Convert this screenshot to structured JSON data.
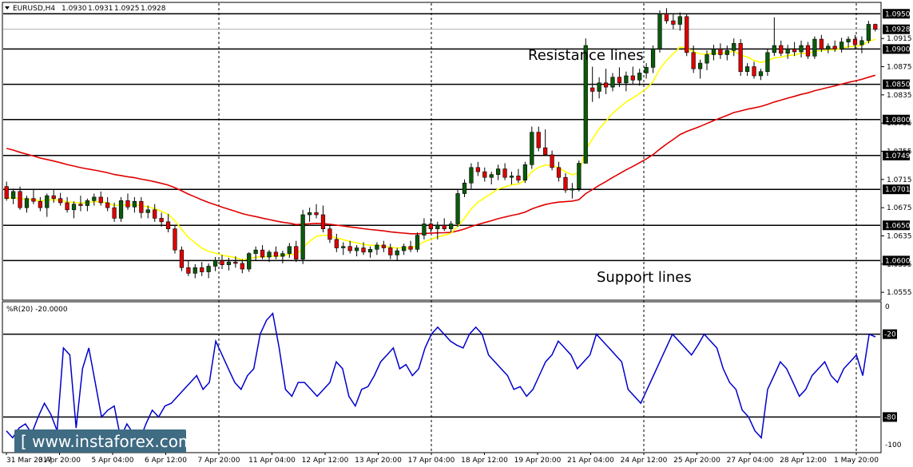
{
  "chart_data": {
    "type": "candlestick",
    "header": {
      "symbol_timeframe": "EURUSD,H4",
      "ohlc": [
        "1.0930",
        "1.0931",
        "1.0925",
        "1.0928"
      ]
    },
    "price_axis": {
      "range": [
        1.0545,
        1.0965
      ],
      "ticks": [
        "1.0915",
        "1.0875",
        "1.0835",
        "1.0795",
        "1.0755",
        "1.0715",
        "1.0675",
        "1.0635",
        "1.0595",
        "1.0555"
      ],
      "current_price": "1.0928"
    },
    "horizontal_levels": [
      {
        "value": 1.095,
        "label": "1.0950"
      },
      {
        "value": 1.09,
        "label": "1.0900"
      },
      {
        "value": 1.085,
        "label": "1.0850"
      },
      {
        "value": 1.08,
        "label": "1.0800"
      },
      {
        "value": 1.0749,
        "label": "1.0749"
      },
      {
        "value": 1.0701,
        "label": "1.0701"
      },
      {
        "value": 1.065,
        "label": "1.0650"
      },
      {
        "value": 1.06,
        "label": "1.0600"
      }
    ],
    "annotations": [
      "Resistance lines",
      "Support lines"
    ],
    "x_labels": [
      "31 Mar 2017",
      "3 Apr 20:00",
      "5 Apr 04:00",
      "6 Apr 12:00",
      "7 Apr 20:00",
      "11 Apr 04:00",
      "12 Apr 12:00",
      "13 Apr 20:00",
      "17 Apr 04:00",
      "18 Apr 12:00",
      "19 Apr 20:00",
      "21 Apr 04:00",
      "24 Apr 12:00",
      "25 Apr 20:00",
      "27 Apr 04:00",
      "28 Apr 12:00",
      "1 May 20:00"
    ],
    "candles": [
      [
        1.0705,
        1.0712,
        1.0685,
        1.0688
      ],
      [
        1.0688,
        1.0702,
        1.068,
        1.0698
      ],
      [
        1.0698,
        1.0705,
        1.0672,
        1.0675
      ],
      [
        1.0675,
        1.0692,
        1.0668,
        1.0688
      ],
      [
        1.0688,
        1.07,
        1.068,
        1.0684
      ],
      [
        1.0684,
        1.069,
        1.067,
        1.0675
      ],
      [
        1.0675,
        1.0695,
        1.0662,
        1.0692
      ],
      [
        1.0692,
        1.07,
        1.0682,
        1.0688
      ],
      [
        1.0688,
        1.0696,
        1.0678,
        1.0682
      ],
      [
        1.0682,
        1.069,
        1.0668,
        1.0672
      ],
      [
        1.0672,
        1.0684,
        1.066,
        1.068
      ],
      [
        1.068,
        1.0692,
        1.067,
        1.0678
      ],
      [
        1.0678,
        1.0688,
        1.067,
        1.0685
      ],
      [
        1.0685,
        1.0695,
        1.0678,
        1.069
      ],
      [
        1.069,
        1.0698,
        1.0678,
        1.0682
      ],
      [
        1.0682,
        1.069,
        1.067,
        1.0675
      ],
      [
        1.0675,
        1.0682,
        1.0655,
        1.066
      ],
      [
        1.066,
        1.069,
        1.0655,
        1.0685
      ],
      [
        1.0685,
        1.0695,
        1.0672,
        1.0676
      ],
      [
        1.0676,
        1.069,
        1.0668,
        1.0684
      ],
      [
        1.0684,
        1.069,
        1.066,
        1.0668
      ],
      [
        1.0668,
        1.0678,
        1.066,
        1.0672
      ],
      [
        1.0672,
        1.068,
        1.0655,
        1.066
      ],
      [
        1.066,
        1.0668,
        1.0648,
        1.0655
      ],
      [
        1.0655,
        1.0666,
        1.064,
        1.0645
      ],
      [
        1.0645,
        1.065,
        1.061,
        1.0615
      ],
      [
        1.0615,
        1.062,
        1.0585,
        1.059
      ],
      [
        1.059,
        1.06,
        1.0578,
        1.0582
      ],
      [
        1.0582,
        1.0595,
        1.0575,
        1.059
      ],
      [
        1.059,
        1.0598,
        1.0578,
        1.0584
      ],
      [
        1.0584,
        1.0596,
        1.0575,
        1.0592
      ],
      [
        1.0592,
        1.0605,
        1.0585,
        1.06
      ],
      [
        1.06,
        1.0608,
        1.0588,
        1.0594
      ],
      [
        1.0594,
        1.0604,
        1.0586,
        1.0598
      ],
      [
        1.0598,
        1.0606,
        1.059,
        1.0596
      ],
      [
        1.0596,
        1.0602,
        1.0582,
        1.0588
      ],
      [
        1.0588,
        1.0612,
        1.0584,
        1.061
      ],
      [
        1.061,
        1.062,
        1.06,
        1.0615
      ],
      [
        1.0615,
        1.0622,
        1.0602,
        1.0605
      ],
      [
        1.0605,
        1.0615,
        1.0598,
        1.0612
      ],
      [
        1.0612,
        1.062,
        1.0602,
        1.0606
      ],
      [
        1.0606,
        1.0614,
        1.0596,
        1.061
      ],
      [
        1.061,
        1.0625,
        1.0604,
        1.062
      ],
      [
        1.062,
        1.0628,
        1.0598,
        1.0602
      ],
      [
        1.0602,
        1.0672,
        1.0595,
        1.0665
      ],
      [
        1.0665,
        1.0675,
        1.0655,
        1.0668
      ],
      [
        1.0668,
        1.068,
        1.066,
        1.0665
      ],
      [
        1.0665,
        1.0678,
        1.064,
        1.0645
      ],
      [
        1.0645,
        1.065,
        1.0625,
        1.063
      ],
      [
        1.063,
        1.0638,
        1.0612,
        1.0618
      ],
      [
        1.0618,
        1.0626,
        1.0608,
        1.062
      ],
      [
        1.062,
        1.0628,
        1.061,
        1.0614
      ],
      [
        1.0614,
        1.0622,
        1.0606,
        1.0618
      ],
      [
        1.0618,
        1.0626,
        1.0608,
        1.0612
      ],
      [
        1.0612,
        1.062,
        1.0604,
        1.0616
      ],
      [
        1.0616,
        1.0626,
        1.0608,
        1.0622
      ],
      [
        1.0622,
        1.0628,
        1.0612,
        1.0618
      ],
      [
        1.0618,
        1.0624,
        1.0602,
        1.0608
      ],
      [
        1.0608,
        1.0618,
        1.06,
        1.0614
      ],
      [
        1.0614,
        1.0624,
        1.0608,
        1.062
      ],
      [
        1.062,
        1.0628,
        1.0612,
        1.0616
      ],
      [
        1.0616,
        1.064,
        1.0612,
        1.0636
      ],
      [
        1.0636,
        1.066,
        1.063,
        1.0652
      ],
      [
        1.0652,
        1.066,
        1.064,
        1.0645
      ],
      [
        1.0645,
        1.0655,
        1.063,
        1.065
      ],
      [
        1.065,
        1.066,
        1.0642,
        1.0645
      ],
      [
        1.0645,
        1.0656,
        1.064,
        1.0652
      ],
      [
        1.0652,
        1.07,
        1.0648,
        1.0695
      ],
      [
        1.0695,
        1.0715,
        1.069,
        1.071
      ],
      [
        1.071,
        1.0738,
        1.0702,
        1.0732
      ],
      [
        1.0732,
        1.074,
        1.072,
        1.0726
      ],
      [
        1.0726,
        1.0732,
        1.0712,
        1.0718
      ],
      [
        1.0718,
        1.0726,
        1.0708,
        1.0722
      ],
      [
        1.0722,
        1.0736,
        1.0714,
        1.073
      ],
      [
        1.073,
        1.0738,
        1.0714,
        1.0718
      ],
      [
        1.0718,
        1.0726,
        1.0708,
        1.072
      ],
      [
        1.072,
        1.073,
        1.071,
        1.0714
      ],
      [
        1.0714,
        1.074,
        1.071,
        1.0736
      ],
      [
        1.0736,
        1.079,
        1.073,
        1.0782
      ],
      [
        1.0782,
        1.079,
        1.0755,
        1.076
      ],
      [
        1.076,
        1.0786,
        1.0752,
        1.075
      ],
      [
        1.075,
        1.0756,
        1.0728,
        1.0732
      ],
      [
        1.0732,
        1.074,
        1.0712,
        1.0718
      ],
      [
        1.0718,
        1.0724,
        1.0696,
        1.07
      ],
      [
        1.07,
        1.071,
        1.0688,
        1.0702
      ],
      [
        1.0702,
        1.0742,
        1.0698,
        1.0738
      ],
      [
        1.0738,
        1.0915,
        1.082,
        1.0905
      ],
      [
        1.0845,
        1.0875,
        1.0825,
        1.084
      ],
      [
        1.084,
        1.086,
        1.083,
        1.0852
      ],
      [
        1.0852,
        1.0872,
        1.0836,
        1.0846
      ],
      [
        1.0846,
        1.0866,
        1.084,
        1.086
      ],
      [
        1.086,
        1.0874,
        1.0846,
        1.0852
      ],
      [
        1.0852,
        1.0868,
        1.084,
        1.0862
      ],
      [
        1.0862,
        1.0875,
        1.085,
        1.0856
      ],
      [
        1.0856,
        1.0872,
        1.0848,
        1.0866
      ],
      [
        1.0866,
        1.088,
        1.0858,
        1.0874
      ],
      [
        1.0874,
        1.0905,
        1.0866,
        1.09
      ],
      [
        1.09,
        1.0955,
        1.0895,
        1.095
      ],
      [
        1.095,
        1.0958,
        1.0936,
        1.094
      ],
      [
        1.094,
        1.095,
        1.0928,
        1.0935
      ],
      [
        1.0935,
        1.0952,
        1.0926,
        1.0946
      ],
      [
        1.0946,
        1.095,
        1.089,
        1.0895
      ],
      [
        1.0895,
        1.0905,
        1.0866,
        1.0872
      ],
      [
        1.0872,
        1.0885,
        1.0858,
        1.088
      ],
      [
        1.088,
        1.0898,
        1.087,
        1.0892
      ],
      [
        1.0892,
        1.0906,
        1.0884,
        1.09
      ],
      [
        1.09,
        1.0908,
        1.0886,
        1.0892
      ],
      [
        1.0892,
        1.0905,
        1.0884,
        1.0898
      ],
      [
        1.0898,
        1.0915,
        1.089,
        1.0908
      ],
      [
        1.0908,
        1.0914,
        1.0862,
        1.0868
      ],
      [
        1.0868,
        1.088,
        1.0862,
        1.0875
      ],
      [
        1.0875,
        1.0882,
        1.0858,
        1.0862
      ],
      [
        1.0862,
        1.0872,
        1.0856,
        1.0868
      ],
      [
        1.0868,
        1.09,
        1.0862,
        1.0895
      ],
      [
        1.0895,
        1.0945,
        1.089,
        1.0905
      ],
      [
        1.0905,
        1.0912,
        1.089,
        1.0894
      ],
      [
        1.0894,
        1.0906,
        1.0886,
        1.09
      ],
      [
        1.09,
        1.091,
        1.089,
        1.0896
      ],
      [
        1.0896,
        1.0912,
        1.0888,
        1.0905
      ],
      [
        1.0905,
        1.091,
        1.0886,
        1.089
      ],
      [
        1.089,
        1.0918,
        1.0886,
        1.0914
      ],
      [
        1.0914,
        1.092,
        1.0896,
        1.09
      ],
      [
        1.09,
        1.0908,
        1.0894,
        1.0904
      ],
      [
        1.0904,
        1.0912,
        1.0896,
        1.09
      ],
      [
        1.09,
        1.0916,
        1.0895,
        1.091
      ],
      [
        1.091,
        1.0918,
        1.0902,
        1.0914
      ],
      [
        1.0914,
        1.092,
        1.09,
        1.0906
      ],
      [
        1.0906,
        1.0918,
        1.0894,
        1.0912
      ],
      [
        1.0912,
        1.094,
        1.0908,
        1.0935
      ],
      [
        1.0935,
        1.0936,
        1.0925,
        1.0928
      ]
    ],
    "ema_fast_color": "#ffff00",
    "ema_slow_color": "#e00000",
    "williams_r": {
      "label": "%R(20) -20.0000",
      "range": [
        -100,
        0
      ],
      "levels": [
        {
          "value": -20,
          "label": "-20"
        },
        {
          "value": -80,
          "label": "-80"
        }
      ],
      "ticks": [
        "0",
        "-100"
      ],
      "line_color": "#0000cc",
      "values": [
        -90,
        -95,
        -88,
        -85,
        -92,
        -80,
        -70,
        -78,
        -90,
        -30,
        -35,
        -88,
        -45,
        -30,
        -55,
        -80,
        -75,
        -72,
        -95,
        -85,
        -92,
        -97,
        -85,
        -75,
        -80,
        -72,
        -70,
        -65,
        -60,
        -55,
        -50,
        -60,
        -55,
        -25,
        -35,
        -45,
        -55,
        -60,
        -50,
        -45,
        -20,
        -10,
        -5,
        -30,
        -60,
        -65,
        -55,
        -55,
        -60,
        -65,
        -60,
        -55,
        -40,
        -45,
        -65,
        -72,
        -60,
        -58,
        -50,
        -40,
        -35,
        -30,
        -45,
        -42,
        -50,
        -45,
        -30,
        -20,
        -15,
        -20,
        -25,
        -28,
        -30,
        -20,
        -15,
        -20,
        -35,
        -40,
        -45,
        -50,
        -60,
        -58,
        -65,
        -60,
        -50,
        -40,
        -35,
        -25,
        -30,
        -35,
        -45,
        -40,
        -35,
        -20,
        -25,
        -30,
        -35,
        -40,
        -60,
        -65,
        -70,
        -60,
        -50,
        -40,
        -30,
        -20,
        -25,
        -30,
        -35,
        -28,
        -20,
        -25,
        -30,
        -45,
        -55,
        -60,
        -75,
        -80,
        -90,
        -95,
        -60,
        -50,
        -40,
        -45,
        -55,
        -65,
        -60,
        -50,
        -45,
        -40,
        -50,
        -55,
        -45,
        -40,
        -35,
        -50,
        -20,
        -22
      ]
    },
    "grid": true,
    "watermark": "[ www.instaforex.com ]"
  }
}
